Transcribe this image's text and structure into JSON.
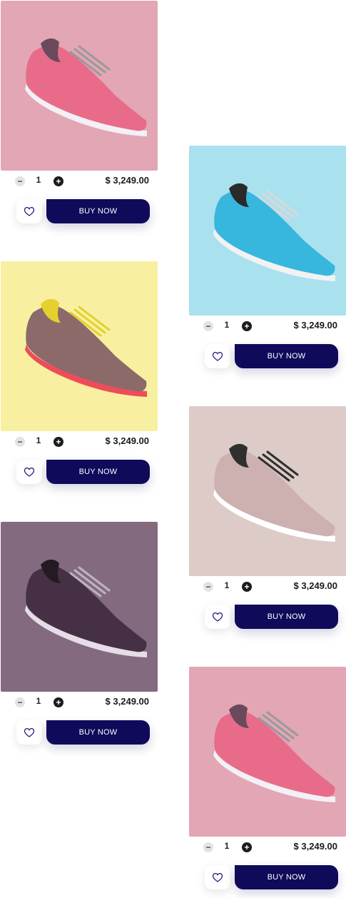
{
  "products": [
    {
      "bg": "#e2a6b5",
      "shoe": "pink",
      "quantity": "1",
      "price": "$ 3,249.00",
      "buy_label": "BUY NOW",
      "icon_fav": "heart-icon",
      "icon_minus": "minus-icon",
      "icon_plus": "plus-icon"
    },
    {
      "bg": "#a9e1ef",
      "shoe": "blue",
      "quantity": "1",
      "price": "$ 3,249.00",
      "buy_label": "BUY NOW",
      "icon_fav": "heart-icon",
      "icon_minus": "minus-icon",
      "icon_plus": "plus-icon"
    },
    {
      "bg": "#f8f0a0",
      "shoe": "brown",
      "quantity": "1",
      "price": "$ 3,249.00",
      "buy_label": "BUY NOW",
      "icon_fav": "heart-icon",
      "icon_minus": "minus-icon",
      "icon_plus": "plus-icon"
    },
    {
      "bg": "#dccbc7",
      "shoe": "beige",
      "quantity": "1",
      "price": "$ 3,249.00",
      "buy_label": "BUY NOW",
      "icon_fav": "heart-icon",
      "icon_minus": "minus-icon",
      "icon_plus": "plus-icon"
    },
    {
      "bg": "#846a7e",
      "shoe": "purple",
      "quantity": "1",
      "price": "$ 3,249.00",
      "buy_label": "BUY NOW",
      "icon_fav": "heart-icon",
      "icon_minus": "minus-icon",
      "icon_plus": "plus-icon"
    },
    {
      "bg": "#e2a6b5",
      "shoe": "pink",
      "quantity": "1",
      "price": "$ 3,249.00",
      "buy_label": "BUY NOW",
      "icon_fav": "heart-icon",
      "icon_minus": "minus-icon",
      "icon_plus": "plus-icon"
    }
  ],
  "colors": {
    "buy_button": "#0f0a5a",
    "heart_stroke": "#1a157a",
    "pink": {
      "body": "#e86b8a",
      "sole": "#f3f0f6",
      "accent": "#6a4a5a",
      "lace": "#9a9a9a"
    },
    "blue": {
      "body": "#37b6de",
      "sole": "#f2f2f2",
      "accent": "#2a2a2a",
      "lace": "#d8d8d8"
    },
    "brown": {
      "body": "#8c6a6a",
      "sole": "#ef4c5a",
      "accent": "#e4d12f",
      "lace": "#e4d12f"
    },
    "beige": {
      "body": "#cdb0b0",
      "sole": "#ffffff",
      "accent": "#2f2f2f",
      "lace": "#2f2f2f"
    },
    "purple": {
      "body": "#453045",
      "sole": "#e7dde9",
      "accent": "#241a24",
      "lace": "#bfb3c0"
    }
  }
}
